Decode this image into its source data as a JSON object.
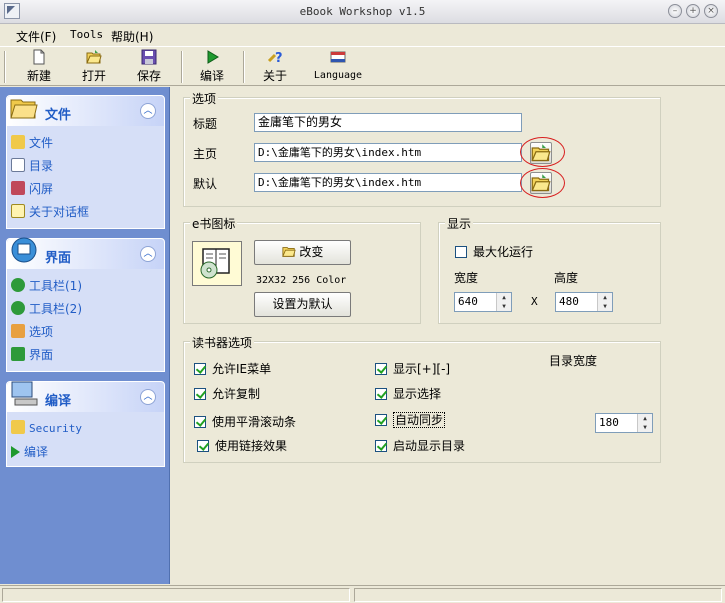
{
  "window": {
    "title": "eBook Workshop v1.5"
  },
  "menu": [
    "文件(F)",
    "Tools",
    "帮助(H)"
  ],
  "toolbar": {
    "new": "新建",
    "open": "打开",
    "save": "保存",
    "compile": "编译",
    "about": "关于",
    "language": "Language"
  },
  "sidebar": {
    "file_group": {
      "title": "文件",
      "items": [
        "文件",
        "目录",
        "闪屏",
        "关于对话框"
      ]
    },
    "ui_group": {
      "title": "界面",
      "items": [
        "工具栏(1)",
        "工具栏(2)",
        "选项",
        "界面"
      ]
    },
    "compile_group": {
      "title": "编译",
      "items": [
        "Security",
        "编译"
      ]
    }
  },
  "options": {
    "title": "选项",
    "title_label": "标题",
    "title_value": "金庸笔下的男女",
    "home_label": "主页",
    "home_value": "D:\\金庸笔下的男女\\index.htm",
    "default_label": "默认",
    "default_value": "D:\\金庸笔下的男女\\index.htm"
  },
  "ebook_icon": {
    "title": "e书图标",
    "change_button": "改变",
    "size_text": "32X32 256 Color",
    "set_default_button": "设置为默认"
  },
  "display": {
    "title": "显示",
    "maximize_label": "最大化运行",
    "maximize_checked": false,
    "width_label": "宽度",
    "width_value": "640",
    "height_label": "高度",
    "height_value": "480",
    "x_label": "X"
  },
  "reader": {
    "title": "读书器选项",
    "left_options": [
      {
        "label": "允许IE菜单",
        "checked": true
      },
      {
        "label": "允许复制",
        "checked": true
      },
      {
        "label": "使用平滑滚动条",
        "checked": true
      },
      {
        "label": "使用链接效果",
        "checked": true
      }
    ],
    "right_options": [
      {
        "label": "显示[+][-]",
        "checked": true
      },
      {
        "label": "显示选择",
        "checked": true
      },
      {
        "label": "自动同步",
        "checked": true
      },
      {
        "label": "启动显示目录",
        "checked": true
      }
    ],
    "toc_width_label": "目录宽度",
    "toc_width_value": "180"
  },
  "colors": {
    "sidebar_bg": "#6f8ed0",
    "group_title": "#215dc6",
    "highlight_ring": "#d81f1f"
  }
}
